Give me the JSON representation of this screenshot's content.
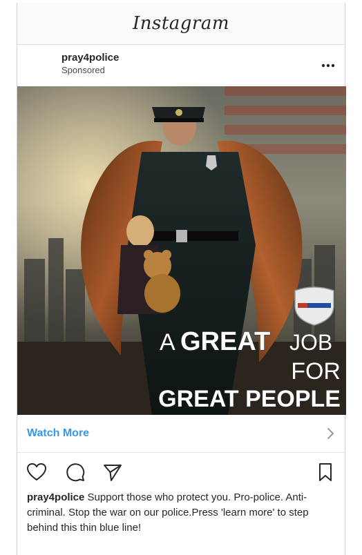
{
  "app": {
    "title": "Instagram"
  },
  "post": {
    "username": "pray4police",
    "label": "Sponsored",
    "image_text": {
      "line1_a": "A",
      "line1_b": "GREAT",
      "line1_c": "JOB",
      "line2": "FOR",
      "line3": "GREAT PEOPLE"
    },
    "cta": "Watch More",
    "caption_user": "pray4police",
    "caption_text": "Support those who protect you. Pro-police. Anti-criminal. Stop the war on our police.Press 'learn more' to step behind this thin blue line!"
  },
  "icons": {
    "more": "more-options-icon",
    "like": "heart-icon",
    "comment": "comment-icon",
    "share": "send-icon",
    "save": "bookmark-icon",
    "chevron": "chevron-right-icon"
  },
  "colors": {
    "link": "#3897f0",
    "text": "#262626"
  }
}
